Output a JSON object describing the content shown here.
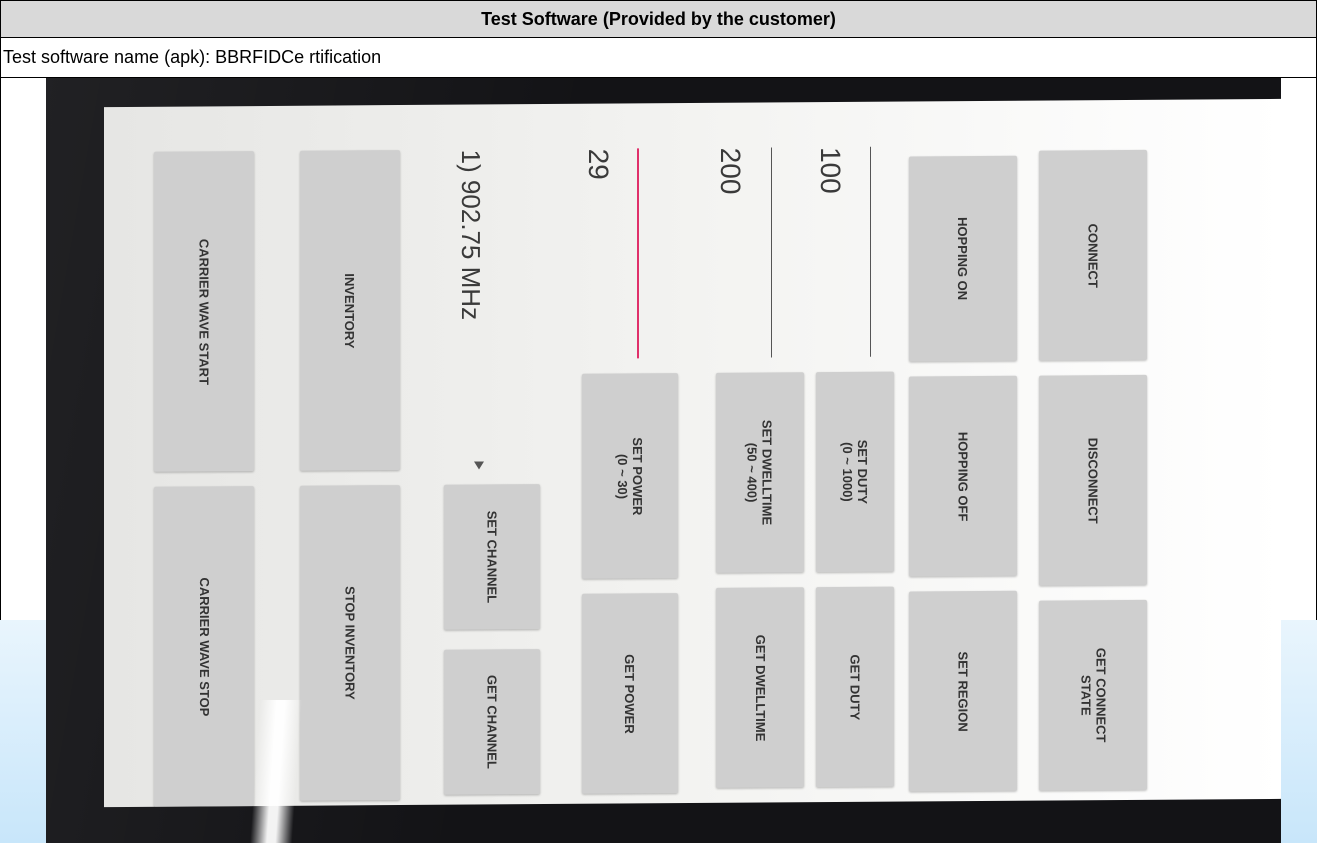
{
  "document": {
    "header": "Test Software (Provided by the customer)",
    "software_name": "Test software name (apk): BBRFIDCe rtification"
  },
  "app": {
    "buttons": {
      "connect": "CONNECT",
      "disconnect": "DISCONNECT",
      "get_connect_state": "GET CONNECT\nSTATE",
      "hopping_on": "HOPPING ON",
      "hopping_off": "HOPPING OFF",
      "set_region": "SET REGION",
      "set_duty": "SET DUTY\n(0 ~ 1000)",
      "get_duty": "GET DUTY",
      "set_dwelltime": "SET DWELLTIME\n(50 ~ 400)",
      "get_dwelltime": "GET DWELLTIME",
      "set_power": "SET POWER\n(0 ~ 30)",
      "get_power": "GET POWER",
      "set_channel": "SET CHANNEL",
      "get_channel": "GET CHANNEL",
      "inventory": "INVENTORY",
      "stop_inventory": "STOP INVENTORY",
      "carrier_wave_start": "CARRIER WAVE START",
      "carrier_wave_stop": "CARRIER WAVE STOP"
    },
    "fields": {
      "duty_value": "100",
      "dwelltime_value": "200",
      "power_value": "29"
    },
    "channel_spinner": {
      "selected": "1) 902.75 MHz"
    },
    "colors": {
      "button_bg": "#cfcfcf",
      "active_underline": "#e0306a",
      "bezel": "#131316"
    }
  }
}
